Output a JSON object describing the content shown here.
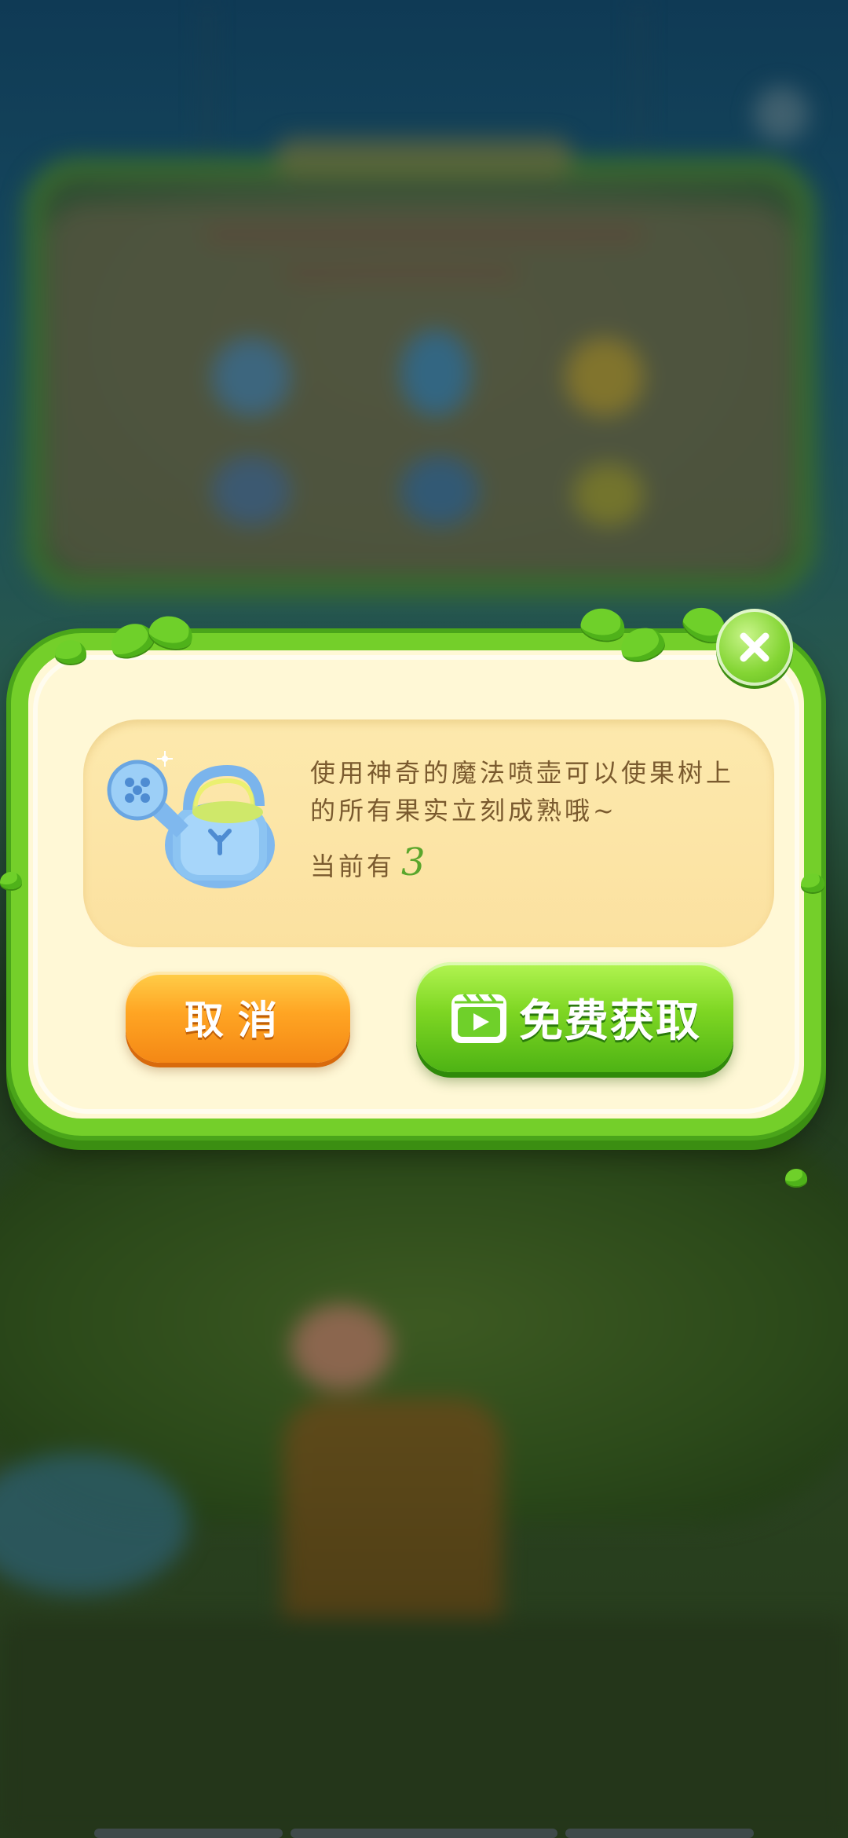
{
  "dialog": {
    "description": "使用神奇的魔法喷壶可以使果树上的所有果实立刻成熟哦~",
    "count_label": "当前有",
    "count_value": "3",
    "cancel_label": "取消",
    "free_label": "免费获取"
  },
  "icons": {
    "item": "watering-can-icon",
    "close": "close-icon",
    "video": "video-play-icon"
  },
  "colors": {
    "frame_green": "#74cf2a",
    "cancel_orange": "#ffa523",
    "free_green": "#7ed623",
    "text_brown": "#7a5a2e",
    "count_green": "#5aa62c"
  }
}
